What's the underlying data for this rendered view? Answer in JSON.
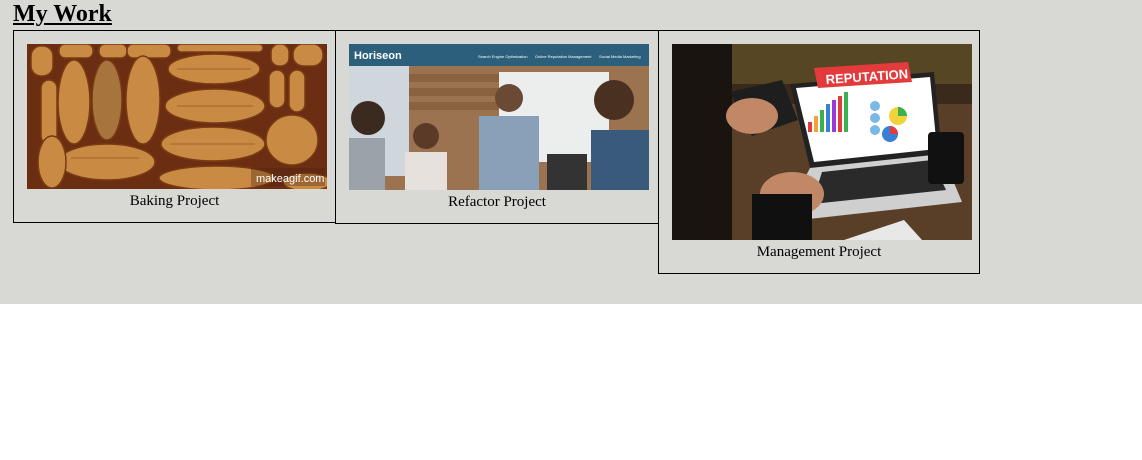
{
  "page": {
    "heading": "My Work"
  },
  "projects": [
    {
      "caption": "Baking Project",
      "image": "bread-loaves-image",
      "watermark": "makeagif.com"
    },
    {
      "caption": "Refactor Project",
      "image": "team-meeting-image",
      "site_brand": "Horiseon",
      "site_nav": [
        "Search Engine Optimization",
        "Online Reputation Management",
        "Social Media Marketing"
      ]
    },
    {
      "caption": "Management Project",
      "image": "laptop-reputation-image",
      "screen_banner": "REPUTATION"
    }
  ]
}
